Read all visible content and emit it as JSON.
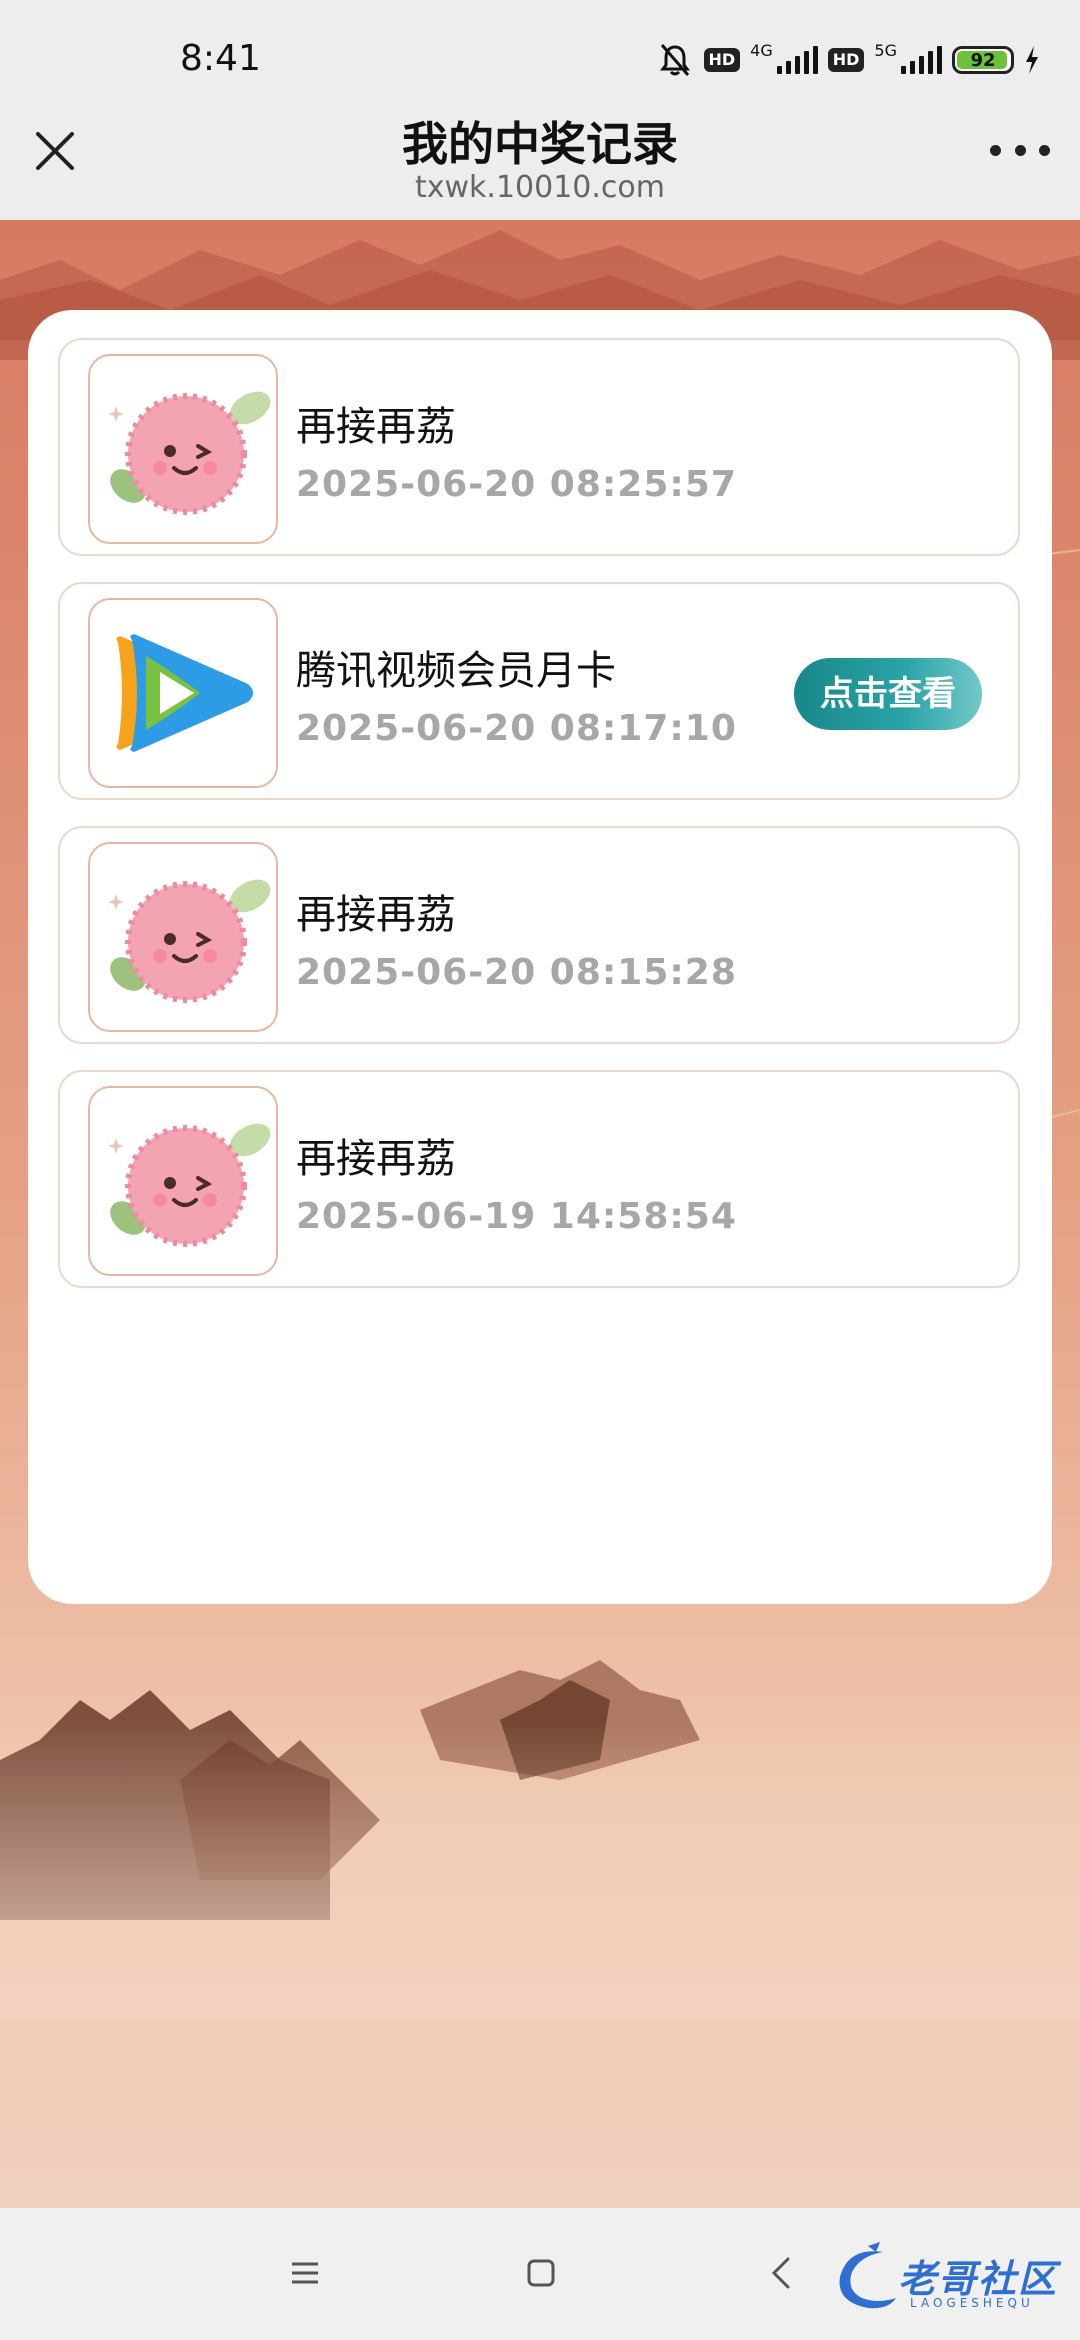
{
  "status_bar": {
    "time": "8:41",
    "hd1": "HD",
    "net1": "4G",
    "hd2": "HD",
    "net2": "5G",
    "battery": "92"
  },
  "header": {
    "title": "我的中奖记录",
    "url": "txwk.10010.com"
  },
  "records": [
    {
      "name": "再接再荔",
      "time": "2025-06-20 08:25:57",
      "icon": "lychee-icon"
    },
    {
      "name": "腾讯视频会员月卡",
      "time": "2025-06-20 08:17:10",
      "icon": "tencent-video-icon",
      "button": "点击查看"
    },
    {
      "name": "再接再荔",
      "time": "2025-06-20 08:15:28",
      "icon": "lychee-icon"
    },
    {
      "name": "再接再荔",
      "time": "2025-06-19 14:58:54",
      "icon": "lychee-icon"
    }
  ],
  "watermark": {
    "text": "老哥社区",
    "sub": "LAOGESHEQU"
  },
  "colors": {
    "accent_button": "#1f9497",
    "time_text": "#a7a7a7",
    "card_border": "#ead9cc"
  }
}
